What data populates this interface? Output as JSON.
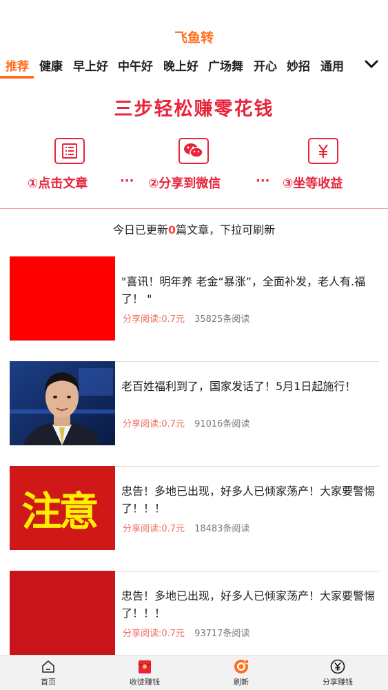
{
  "app": {
    "title": "飞鱼转"
  },
  "tabs": [
    {
      "label": "推荐",
      "active": true
    },
    {
      "label": "健康"
    },
    {
      "label": "早上好"
    },
    {
      "label": "中午好"
    },
    {
      "label": "晚上好"
    },
    {
      "label": "广场舞"
    },
    {
      "label": "开心"
    },
    {
      "label": "妙招"
    },
    {
      "label": "通用"
    }
  ],
  "promo": {
    "title": "三步轻松赚零花钱",
    "steps": [
      {
        "label": "①点击文章",
        "icon": "article-icon"
      },
      {
        "label": "②分享到微信",
        "icon": "wechat-icon"
      },
      {
        "label": "③坐等收益",
        "icon": "yuan-icon"
      }
    ],
    "separator": "···"
  },
  "refresh_note": {
    "prefix": "今日已更新",
    "count": "0",
    "suffix": "篇文章，下拉可刷新"
  },
  "articles": [
    {
      "title": "\"喜讯！明年养 老金“暴涨”，全面补发，老人有.福了！ \"",
      "reward": "分享阅读:0.7元",
      "reads": "35825条阅读"
    },
    {
      "title": "老百姓福利到了，国家发话了！5月1日起施行！",
      "reward": "分享阅读:0.7元",
      "reads": "91016条阅读"
    },
    {
      "title": "忠告！多地已出现，好多人已倾家荡产！大家要警惕了！！！",
      "thumb_text": "注意",
      "reward": "分享阅读:0.7元",
      "reads": "18483条阅读"
    },
    {
      "title": "忠告！多地已出现，好多人已倾家荡产！大家要警惕了！！！",
      "reward": "分享阅读:0.7元",
      "reads": "93717条阅读"
    }
  ],
  "bottom_nav": [
    {
      "label": "首页",
      "icon": "home-icon"
    },
    {
      "label": "收徒赚钱",
      "icon": "red-envelope-icon"
    },
    {
      "label": "刷新",
      "icon": "refresh-icon"
    },
    {
      "label": "分享赚钱",
      "icon": "yuan-circle-icon"
    }
  ],
  "colors": {
    "accent": "#ff6f1e",
    "promo_red": "#e8233a",
    "reward": "#f06a5a"
  }
}
